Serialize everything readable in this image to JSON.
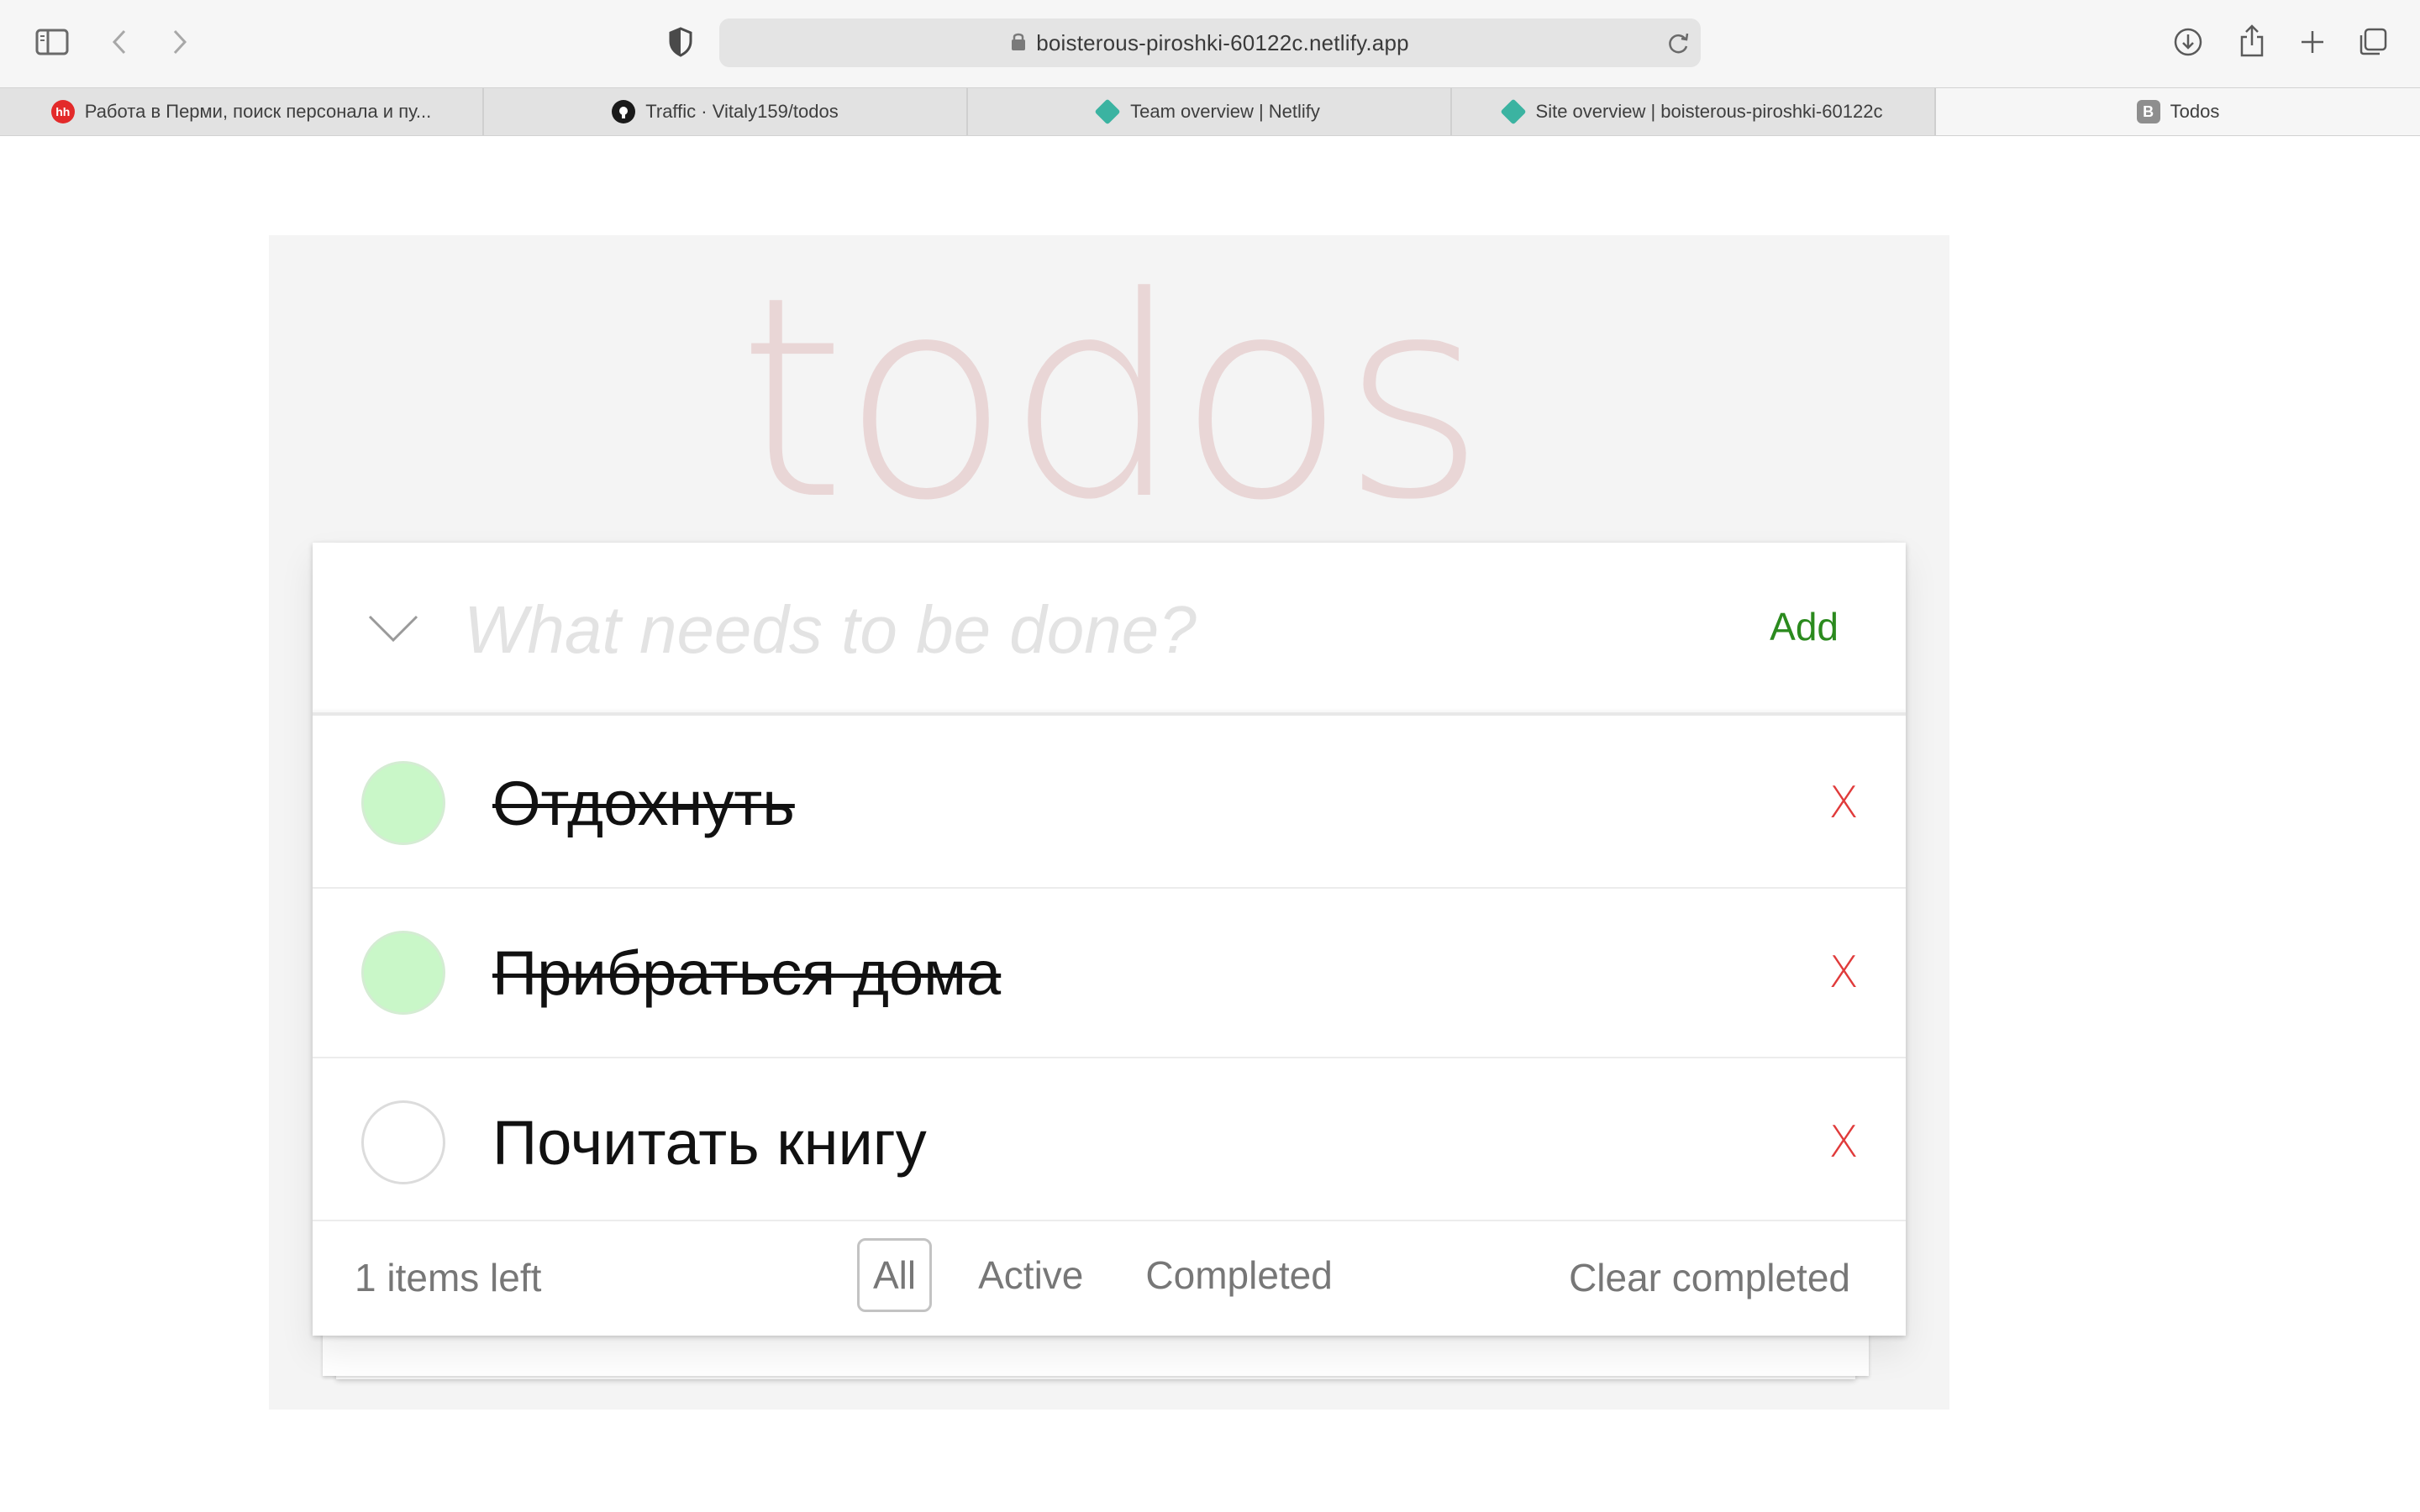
{
  "browser": {
    "url": "boisterous-piroshki-60122c.netlify.app",
    "tabs": [
      {
        "label": "Работа в Перми, поиск персонала и пу...",
        "favicon": "hh",
        "favicon_text": "hh"
      },
      {
        "label": "Traffic · Vitaly159/todos",
        "favicon": "github-icon"
      },
      {
        "label": "Team overview | Netlify",
        "favicon": "netlify-icon"
      },
      {
        "label": "Site overview | boisterous-piroshki-60122c",
        "favicon": "netlify-icon"
      },
      {
        "label": "Todos",
        "favicon": "letter-b-icon",
        "favicon_text": "B",
        "active": true
      }
    ]
  },
  "app": {
    "title": "todos",
    "new_todo_placeholder": "What needs to be done?",
    "add_label": "Add",
    "todos": [
      {
        "text": "Отдохнуть",
        "completed": true
      },
      {
        "text": "Прибраться дома",
        "completed": true
      },
      {
        "text": "Почитать книгу",
        "completed": false
      }
    ],
    "delete_label": "X",
    "footer": {
      "count_text": "1 items left",
      "filters": [
        {
          "label": "All",
          "selected": true
        },
        {
          "label": "Active",
          "selected": false
        },
        {
          "label": "Completed",
          "selected": false
        }
      ],
      "clear_label": "Clear completed"
    }
  },
  "colors": {
    "add": "#2b8a1e",
    "delete": "#e03b3b",
    "completed_check": "#c9f7c8",
    "title": "rgba(175,47,47,0.15)"
  }
}
